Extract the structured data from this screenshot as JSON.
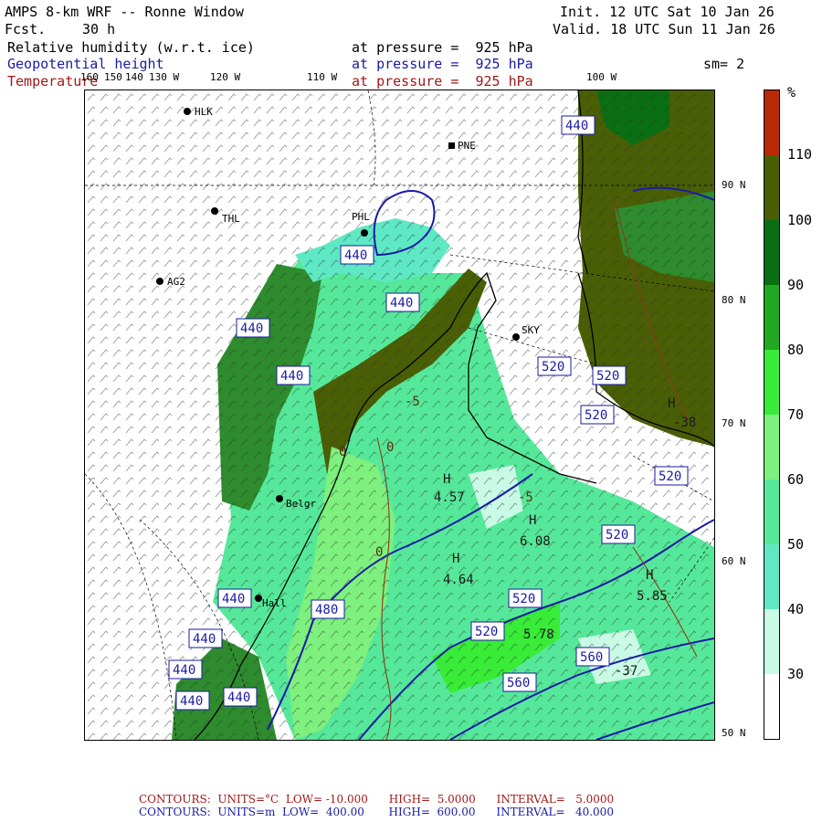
{
  "header": {
    "title": "AMPS 8-km WRF -- Ronne Window",
    "fcst_label": "Fcst.",
    "fcst_value": "30 h",
    "init": "Init. 12 UTC Sat 10 Jan 26",
    "valid": "Valid. 18 UTC Sun 11 Jan 26",
    "smooth": "sm= 2"
  },
  "fields": [
    {
      "name": "Relative humidity (w.r.t. ice)",
      "level": "at pressure =  925 hPa",
      "color": "#000000"
    },
    {
      "name": "Geopotential height",
      "level": "at pressure =  925 hPa",
      "color": "#1a1aa6"
    },
    {
      "name": "Temperature",
      "level": "at pressure =  925 hPa",
      "color": "#a01818"
    }
  ],
  "lon_labels": [
    "160",
    "150",
    "140",
    "130 W",
    "120 W",
    "110 W",
    "100 W"
  ],
  "lat_labels": [
    "90 N",
    "80 N",
    "70 N",
    "60 N",
    "50 N"
  ],
  "stations": [
    {
      "id": "HLK"
    },
    {
      "id": "PNE"
    },
    {
      "id": "THL"
    },
    {
      "id": "PHL"
    },
    {
      "id": "AG2"
    },
    {
      "id": "SKY"
    },
    {
      "id": "Belgr"
    },
    {
      "id": "Hall"
    }
  ],
  "height_contour_labels": [
    "440",
    "440",
    "440",
    "440",
    "440",
    "440",
    "440",
    "440",
    "440",
    "440",
    "480",
    "520",
    "520",
    "520",
    "520",
    "520",
    "520",
    "560",
    "560",
    "520"
  ],
  "temp_contour_labels": [
    "0",
    "0",
    "0",
    "-5",
    "-5"
  ],
  "extrema": [
    {
      "type": "H",
      "value": "4.57"
    },
    {
      "type": "H",
      "value": "6.08"
    },
    {
      "type": "H",
      "value": "4.64"
    },
    {
      "type": "H",
      "value": "5.85"
    },
    {
      "type": "H",
      "value": "5.78"
    },
    {
      "type": "H",
      "value": "-38"
    },
    {
      "type": "H",
      "value": "-37"
    }
  ],
  "legend": {
    "unit": "%",
    "labels": [
      "110",
      "100",
      "90",
      "80",
      "70",
      "60",
      "50",
      "40",
      "30"
    ],
    "colors": [
      "#b82a08",
      "#4a5e06",
      "#0a6e12",
      "#20a820",
      "#38ec38",
      "#7ef07e",
      "#56e89a",
      "#5ee8c4",
      "#c8fae6",
      "#ffffff"
    ]
  },
  "footer": {
    "line1": "CONTOURS:  UNITS=°C  LOW= -10.000      HIGH=  5.0000      INTERVAL=   5.0000",
    "line2": "CONTOURS:  UNITS=m  LOW=  400.00       HIGH=  600.00      INTERVAL=   40.000",
    "line1_color": "#a01818",
    "line2_color": "#1a1aa6"
  }
}
